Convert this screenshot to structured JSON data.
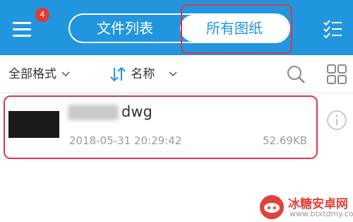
{
  "header": {
    "badge_count": "4",
    "tabs": [
      {
        "label": "文件列表",
        "active": false
      },
      {
        "label": "所有图纸",
        "active": true
      }
    ]
  },
  "filters": {
    "format_label": "全部格式",
    "sort_label": "名称"
  },
  "files": [
    {
      "name": "dwg",
      "date": "2018-05-31 20:29:42",
      "size": "52.69KB"
    }
  ],
  "watermark": {
    "title": "冰糖安卓网",
    "url": "www.btxtdmy.com"
  },
  "colors": {
    "primary": "#2196de",
    "badge": "#e33b32",
    "highlight": "#d8384f",
    "muted_text": "#9b9b9b"
  },
  "icons": [
    "menu-icon",
    "checklist-icon",
    "chevron-down-icon",
    "sort-icon",
    "search-icon",
    "grid-icon",
    "info-icon"
  ]
}
